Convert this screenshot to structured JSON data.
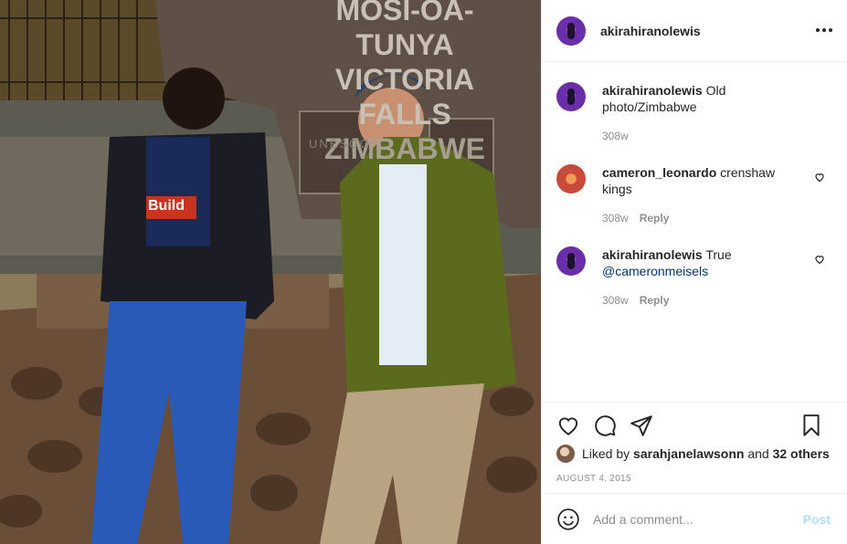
{
  "photo": {
    "sign_lines": [
      "MOSI-OA-TUNYA",
      "VICTORIA FALLS",
      "ZIMBABWE"
    ],
    "plaque_text": "UNESCO",
    "shirt_text": "Build"
  },
  "post": {
    "author": "akirahiranolewis",
    "more_icon": "more-horizontal-icon"
  },
  "comments": [
    {
      "user": "akirahiranolewis",
      "text": "Old photo/Zimbabwe",
      "mention": "",
      "time": "308w",
      "reply": "",
      "liked": false
    },
    {
      "user": "cameron_leonardo",
      "text": "crenshaw kings",
      "mention": "",
      "time": "308w",
      "reply": "Reply",
      "liked": true
    },
    {
      "user": "akirahiranolewis",
      "text": "True",
      "mention": "@cameronmeisels",
      "time": "308w",
      "reply": "Reply",
      "liked": true
    }
  ],
  "actions": {
    "icons": [
      "heart-icon",
      "comment-icon",
      "share-icon",
      "bookmark-icon"
    ],
    "liked_prefix": "Liked by",
    "liked_user": "sarahjanelawsonn",
    "liked_and": "and",
    "liked_others": "32 others",
    "date": "AUGUST 4, 2015"
  },
  "add_comment": {
    "placeholder": "Add a comment...",
    "post_label": "Post"
  },
  "colors": {
    "link": "#00376b",
    "post_disabled": "#b3dbff",
    "muted": "#8e8e8e"
  }
}
